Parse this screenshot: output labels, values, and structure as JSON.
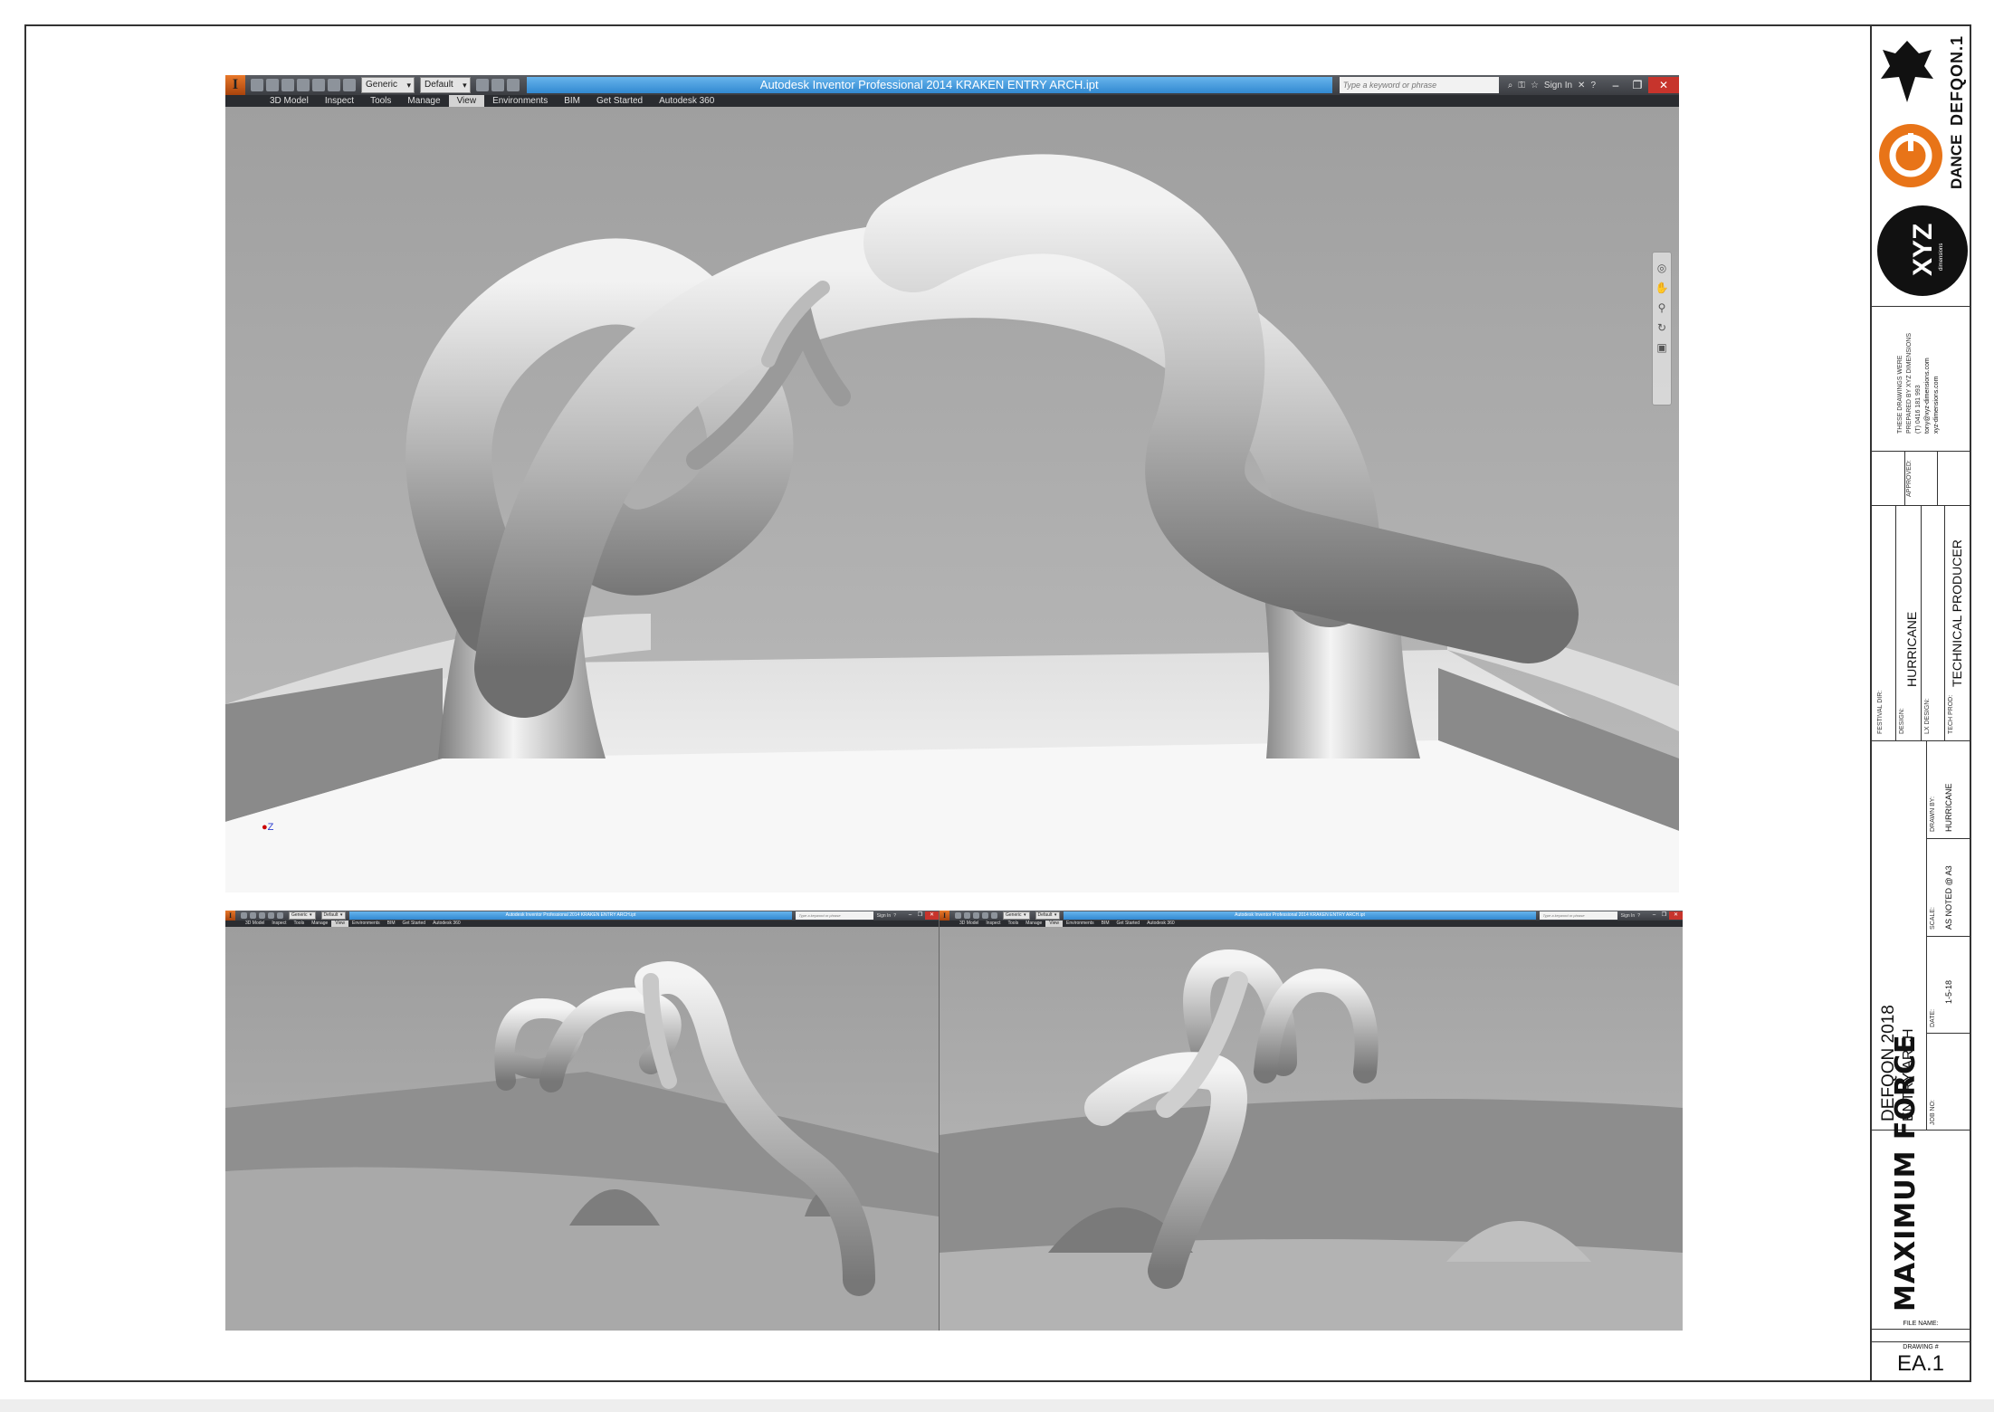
{
  "app": {
    "name_letter": "I",
    "title": "Autodesk Inventor Professional 2014   KRAKEN ENTRY ARCH.ipt",
    "material_dropdown": "Generic",
    "appearance_dropdown": "Default",
    "search_placeholder": "Type a keyword or phrase",
    "sign_in": "Sign In",
    "help": "?",
    "tabs": [
      "3D Model",
      "Inspect",
      "Tools",
      "Manage",
      "View",
      "Environments",
      "BIM",
      "Get Started",
      "Autodesk 360"
    ],
    "active_tab": "View",
    "axis_label": "Z",
    "colors": {
      "title_bar": "#3b3d42",
      "title_field": "#3289d1",
      "close_button": "#c7342c",
      "viewport_bg": "#b9b9b9"
    }
  },
  "title_block": {
    "logos": {
      "defqon": "DEFQON.1",
      "dance": "DANCE",
      "xyz": "XYZ",
      "xyz_sub": "dimensions"
    },
    "prepared_by": [
      "THESE DRAWINGS WERE",
      "PREPARED BY XYZ DIMENSIONS",
      "(T) 0416 181 993",
      "tony@xyz-dimensions.com",
      "xyz-dimensions.com"
    ],
    "approved_label": "APPROVED:",
    "festival_dir_label": "FESTIVAL DIR:",
    "design_label": "DESIGN:",
    "design_value": "HURRICANE",
    "lx_design_label": "LX DESIGN:",
    "tech_prod_label": "TECH PROD:",
    "tech_prod_value": "TECHNICAL PRODUCER",
    "drawn_by_label": "DRAWN BY:",
    "drawn_by_value": "HURRICANE",
    "scale_label": "SCALE:",
    "scale_value": "AS NOTED @ A3",
    "date_label": "DATE:",
    "date_value": "1-5-18",
    "job_no_label": "JOB NO:",
    "project": "DEFQON 2018",
    "drawing_title": "ENTRY ARCH",
    "client_logo": "MAXIMUM FORCE",
    "file_name_label": "FILE NAME:",
    "drawing_no_label": "DRAWING #",
    "drawing_no": "EA.1"
  }
}
